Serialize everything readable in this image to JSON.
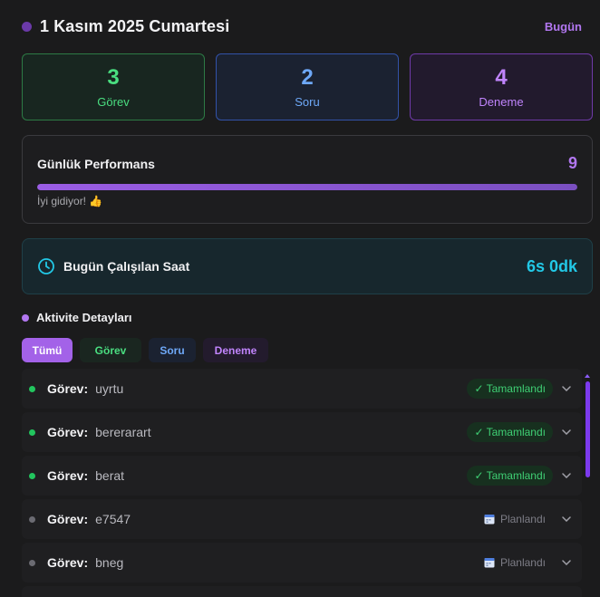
{
  "header": {
    "title": "1 Kasım 2025 Cumartesi",
    "today_label": "Bugün"
  },
  "stats": [
    {
      "value": "3",
      "label": "Görev"
    },
    {
      "value": "2",
      "label": "Soru"
    },
    {
      "value": "4",
      "label": "Deneme"
    }
  ],
  "performance": {
    "title": "Günlük Performans",
    "score": "9",
    "progress_fraction": 1.0,
    "message": "İyi gidiyor! 👍"
  },
  "hours": {
    "label": "Bugün Çalışılan Saat",
    "value": "6s 0dk",
    "icon": "clock-icon"
  },
  "activity": {
    "title": "Aktivite Detayları",
    "filters": [
      {
        "label": "Tümü",
        "active": true
      },
      {
        "label": "Görev"
      },
      {
        "label": "Soru"
      },
      {
        "label": "Deneme"
      }
    ],
    "items": [
      {
        "type": "Görev:",
        "name": "uyrtu",
        "status": "✓ Tamamlandı",
        "state": "done"
      },
      {
        "type": "Görev:",
        "name": "bererarart",
        "status": "✓ Tamamlandı",
        "state": "done"
      },
      {
        "type": "Görev:",
        "name": "berat",
        "status": "✓ Tamamlandı",
        "state": "done"
      },
      {
        "type": "Görev:",
        "name": "e7547",
        "status": "Planlandı",
        "state": "plan"
      },
      {
        "type": "Görev:",
        "name": "bneg",
        "status": "Planlandı",
        "state": "plan"
      }
    ]
  },
  "colors": {
    "accent_purple": "#b277f0",
    "green": "#4ade80",
    "blue": "#6ea8f7",
    "cyan": "#22c8e6"
  }
}
